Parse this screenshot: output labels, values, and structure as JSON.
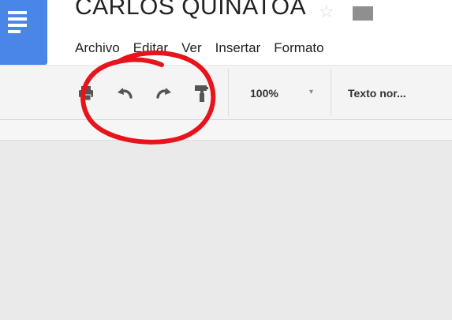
{
  "document": {
    "title": "CARLOS QUINATOA"
  },
  "menubar": {
    "items": [
      {
        "label": "Archivo"
      },
      {
        "label": "Editar"
      },
      {
        "label": "Ver"
      },
      {
        "label": "Insertar"
      },
      {
        "label": "Formato"
      }
    ]
  },
  "toolbar": {
    "zoom_value": "100%",
    "zoom_caret": "▾",
    "paragraph_style": "Texto nor..."
  },
  "icons": {
    "star": "star-icon",
    "folder": "folder-icon",
    "print": "print-icon",
    "undo": "undo-icon",
    "redo": "redo-icon",
    "paint_format": "paint-format-icon"
  },
  "colors": {
    "docs_blue": "#4a86e8",
    "annotation_red": "#e8141c",
    "toolbar_bg": "#f4f4f4",
    "canvas_bg": "#eaeaea"
  },
  "annotation": {
    "shape": "hand-drawn red circle around undo, redo and paint-format buttons"
  }
}
